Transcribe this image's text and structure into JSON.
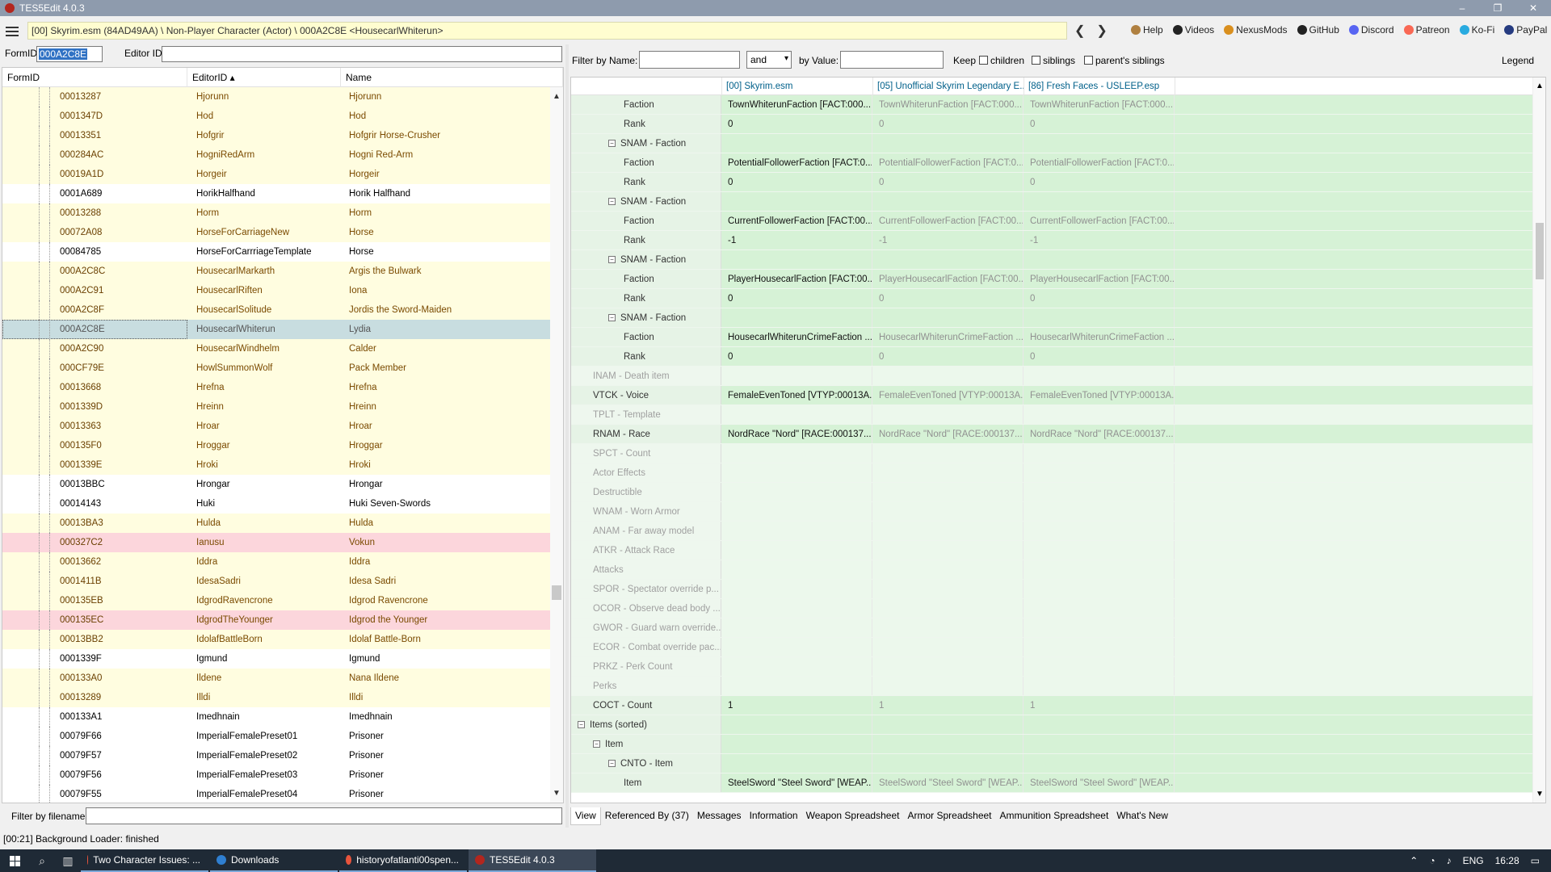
{
  "window": {
    "title": "TES5Edit 4.0.3",
    "controls": [
      "–",
      "❐",
      "✕"
    ]
  },
  "pathbar": {
    "path": "[00] Skyrim.esm (84AD49AA) \\ Non-Player Character (Actor) \\ 000A2C8E <HousecarlWhiterun>"
  },
  "nav": {
    "back": "❮",
    "forward": "❯"
  },
  "links": [
    {
      "label": "Help",
      "color": "#b08040"
    },
    {
      "label": "Videos",
      "color": "#222222"
    },
    {
      "label": "NexusMods",
      "color": "#d98f1e"
    },
    {
      "label": "GitHub",
      "color": "#222222"
    },
    {
      "label": "Discord",
      "color": "#5865f2"
    },
    {
      "label": "Patreon",
      "color": "#f96854"
    },
    {
      "label": "Ko-Fi",
      "color": "#29abe0"
    },
    {
      "label": "PayPal",
      "color": "#253b80"
    }
  ],
  "left_filter": {
    "formid_label": "FormID",
    "formid_value": "000A2C8E",
    "editorid_label": "Editor ID",
    "editorid_value": ""
  },
  "left_columns": [
    "FormID",
    "EditorID ▴",
    "Name"
  ],
  "left_rows": [
    {
      "formid": "00013287",
      "editorid": "Hjorunn",
      "name": "Hjorunn",
      "style": "y"
    },
    {
      "formid": "0001347D",
      "editorid": "Hod",
      "name": "Hod",
      "style": "y"
    },
    {
      "formid": "00013351",
      "editorid": "Hofgrir",
      "name": "Hofgrir Horse-Crusher",
      "style": "y"
    },
    {
      "formid": "000284AC",
      "editorid": "HogniRedArm",
      "name": "Hogni Red-Arm",
      "style": "y"
    },
    {
      "formid": "00019A1D",
      "editorid": "Horgeir",
      "name": "Horgeir",
      "style": "y"
    },
    {
      "formid": "0001A689",
      "editorid": "HorikHalfhand",
      "name": "Horik Halfhand",
      "style": "w"
    },
    {
      "formid": "00013288",
      "editorid": "Horm",
      "name": "Horm",
      "style": "y"
    },
    {
      "formid": "00072A08",
      "editorid": "HorseForCarriageNew",
      "name": "Horse",
      "style": "y"
    },
    {
      "formid": "00084785",
      "editorid": "HorseForCarrriageTemplate",
      "name": "Horse",
      "style": "w"
    },
    {
      "formid": "000A2C8C",
      "editorid": "HousecarlMarkarth",
      "name": "Argis the Bulwark",
      "style": "y"
    },
    {
      "formid": "000A2C91",
      "editorid": "HousecarlRiften",
      "name": "Iona",
      "style": "y"
    },
    {
      "formid": "000A2C8F",
      "editorid": "HousecarlSolitude",
      "name": "Jordis the Sword-Maiden",
      "style": "y"
    },
    {
      "formid": "000A2C8E",
      "editorid": "HousecarlWhiterun",
      "name": "Lydia",
      "style": "sel"
    },
    {
      "formid": "000A2C90",
      "editorid": "HousecarlWindhelm",
      "name": "Calder",
      "style": "y"
    },
    {
      "formid": "000CF79E",
      "editorid": "HowlSummonWolf",
      "name": "Pack Member",
      "style": "y"
    },
    {
      "formid": "00013668",
      "editorid": "Hrefna",
      "name": "Hrefna",
      "style": "y"
    },
    {
      "formid": "0001339D",
      "editorid": "Hreinn",
      "name": "Hreinn",
      "style": "y"
    },
    {
      "formid": "00013363",
      "editorid": "Hroar",
      "name": "Hroar",
      "style": "y"
    },
    {
      "formid": "000135F0",
      "editorid": "Hroggar",
      "name": "Hroggar",
      "style": "y"
    },
    {
      "formid": "0001339E",
      "editorid": "Hroki",
      "name": "Hroki",
      "style": "y"
    },
    {
      "formid": "00013BBC",
      "editorid": "Hrongar",
      "name": "Hrongar",
      "style": "w"
    },
    {
      "formid": "00014143",
      "editorid": "Huki",
      "name": "Huki Seven-Swords",
      "style": "w"
    },
    {
      "formid": "00013BA3",
      "editorid": "Hulda",
      "name": "Hulda",
      "style": "y"
    },
    {
      "formid": "000327C2",
      "editorid": "Ianusu",
      "name": "Vokun",
      "style": "p"
    },
    {
      "formid": "00013662",
      "editorid": "Iddra",
      "name": "Iddra",
      "style": "y"
    },
    {
      "formid": "0001411B",
      "editorid": "IdesaSadri",
      "name": "Idesa Sadri",
      "style": "y"
    },
    {
      "formid": "000135EB",
      "editorid": "IdgrodRavencrone",
      "name": "Idgrod Ravencrone",
      "style": "y"
    },
    {
      "formid": "000135EC",
      "editorid": "IdgrodTheYounger",
      "name": "Idgrod the Younger",
      "style": "p"
    },
    {
      "formid": "00013BB2",
      "editorid": "IdolafBattleBorn",
      "name": "Idolaf Battle-Born",
      "style": "y"
    },
    {
      "formid": "0001339F",
      "editorid": "Igmund",
      "name": "Igmund",
      "style": "w"
    },
    {
      "formid": "000133A0",
      "editorid": "Ildene",
      "name": "Nana Ildene",
      "style": "y"
    },
    {
      "formid": "00013289",
      "editorid": "Illdi",
      "name": "Illdi",
      "style": "y"
    },
    {
      "formid": "000133A1",
      "editorid": "Imedhnain",
      "name": "Imedhnain",
      "style": "w"
    },
    {
      "formid": "00079F66",
      "editorid": "ImperialFemalePreset01",
      "name": "Prisoner",
      "style": "w"
    },
    {
      "formid": "00079F57",
      "editorid": "ImperialFemalePreset02",
      "name": "Prisoner",
      "style": "w"
    },
    {
      "formid": "00079F56",
      "editorid": "ImperialFemalePreset03",
      "name": "Prisoner",
      "style": "w"
    },
    {
      "formid": "00079F55",
      "editorid": "ImperialFemalePreset04",
      "name": "Prisoner",
      "style": "w"
    }
  ],
  "filename_filter": {
    "label": "Filter by filename:",
    "value": ""
  },
  "right_filter": {
    "by_name_label": "Filter by Name:",
    "operator": "and",
    "by_value_label": "by Value:",
    "keep_label": "Keep",
    "children_label": "children",
    "siblings_label": "siblings",
    "parents_siblings_label": "parent's siblings",
    "legend_label": "Legend"
  },
  "right_columns": [
    "",
    "[00] Skyrim.esm",
    "[05] Unofficial Skyrim Legendary E...",
    "[86] Fresh Faces - USLEEP.esp"
  ],
  "right_rows": [
    {
      "label": "Faction",
      "indent": 3,
      "toggle": "",
      "v": [
        "TownWhiterunFaction [FACT:000...",
        "TownWhiterunFaction [FACT:000...",
        "TownWhiterunFaction [FACT:000..."
      ],
      "empty": false
    },
    {
      "label": "Rank",
      "indent": 3,
      "toggle": "",
      "v": [
        "0",
        "0",
        "0"
      ],
      "empty": false
    },
    {
      "label": "SNAM - Faction",
      "indent": 2,
      "toggle": "⊟",
      "v": [
        "",
        "",
        ""
      ],
      "empty": false
    },
    {
      "label": "Faction",
      "indent": 3,
      "toggle": "",
      "v": [
        "PotentialFollowerFaction [FACT:0...",
        "PotentialFollowerFaction [FACT:0...",
        "PotentialFollowerFaction [FACT:0..."
      ],
      "empty": false
    },
    {
      "label": "Rank",
      "indent": 3,
      "toggle": "",
      "v": [
        "0",
        "0",
        "0"
      ],
      "empty": false
    },
    {
      "label": "SNAM - Faction",
      "indent": 2,
      "toggle": "⊟",
      "v": [
        "",
        "",
        ""
      ],
      "empty": false
    },
    {
      "label": "Faction",
      "indent": 3,
      "toggle": "",
      "v": [
        "CurrentFollowerFaction [FACT:00...",
        "CurrentFollowerFaction [FACT:00...",
        "CurrentFollowerFaction [FACT:00..."
      ],
      "empty": false
    },
    {
      "label": "Rank",
      "indent": 3,
      "toggle": "",
      "v": [
        "-1",
        "-1",
        "-1"
      ],
      "empty": false
    },
    {
      "label": "SNAM - Faction",
      "indent": 2,
      "toggle": "⊟",
      "v": [
        "",
        "",
        ""
      ],
      "empty": false
    },
    {
      "label": "Faction",
      "indent": 3,
      "toggle": "",
      "v": [
        "PlayerHousecarlFaction [FACT:00...",
        "PlayerHousecarlFaction [FACT:00...",
        "PlayerHousecarlFaction [FACT:00..."
      ],
      "empty": false
    },
    {
      "label": "Rank",
      "indent": 3,
      "toggle": "",
      "v": [
        "0",
        "0",
        "0"
      ],
      "empty": false
    },
    {
      "label": "SNAM - Faction",
      "indent": 2,
      "toggle": "⊟",
      "v": [
        "",
        "",
        ""
      ],
      "empty": false
    },
    {
      "label": "Faction",
      "indent": 3,
      "toggle": "",
      "v": [
        "HousecarlWhiterunCrimeFaction ...",
        "HousecarlWhiterunCrimeFaction ...",
        "HousecarlWhiterunCrimeFaction ..."
      ],
      "empty": false
    },
    {
      "label": "Rank",
      "indent": 3,
      "toggle": "",
      "v": [
        "0",
        "0",
        "0"
      ],
      "empty": false
    },
    {
      "label": "INAM - Death item",
      "indent": 1,
      "toggle": "",
      "v": [
        "",
        "",
        ""
      ],
      "empty": true
    },
    {
      "label": "VTCK - Voice",
      "indent": 1,
      "toggle": "",
      "v": [
        "FemaleEvenToned [VTYP:00013A...",
        "FemaleEvenToned [VTYP:00013A...",
        "FemaleEvenToned [VTYP:00013A..."
      ],
      "empty": false
    },
    {
      "label": "TPLT - Template",
      "indent": 1,
      "toggle": "",
      "v": [
        "",
        "",
        ""
      ],
      "empty": true
    },
    {
      "label": "RNAM - Race",
      "indent": 1,
      "toggle": "",
      "v": [
        "NordRace \"Nord\" [RACE:000137...",
        "NordRace \"Nord\" [RACE:000137...",
        "NordRace \"Nord\" [RACE:000137..."
      ],
      "empty": false
    },
    {
      "label": "SPCT - Count",
      "indent": 1,
      "toggle": "",
      "v": [
        "",
        "",
        ""
      ],
      "empty": true
    },
    {
      "label": "Actor Effects",
      "indent": 1,
      "toggle": "",
      "v": [
        "",
        "",
        ""
      ],
      "empty": true
    },
    {
      "label": "Destructible",
      "indent": 1,
      "toggle": "",
      "v": [
        "",
        "",
        ""
      ],
      "empty": true
    },
    {
      "label": "WNAM - Worn Armor",
      "indent": 1,
      "toggle": "",
      "v": [
        "",
        "",
        ""
      ],
      "empty": true
    },
    {
      "label": "ANAM - Far away model",
      "indent": 1,
      "toggle": "",
      "v": [
        "",
        "",
        ""
      ],
      "empty": true
    },
    {
      "label": "ATKR - Attack Race",
      "indent": 1,
      "toggle": "",
      "v": [
        "",
        "",
        ""
      ],
      "empty": true
    },
    {
      "label": "Attacks",
      "indent": 1,
      "toggle": "",
      "v": [
        "",
        "",
        ""
      ],
      "empty": true
    },
    {
      "label": "SPOR - Spectator override p...",
      "indent": 1,
      "toggle": "",
      "v": [
        "",
        "",
        ""
      ],
      "empty": true
    },
    {
      "label": "OCOR - Observe dead body ...",
      "indent": 1,
      "toggle": "",
      "v": [
        "",
        "",
        ""
      ],
      "empty": true
    },
    {
      "label": "GWOR - Guard warn override...",
      "indent": 1,
      "toggle": "",
      "v": [
        "",
        "",
        ""
      ],
      "empty": true
    },
    {
      "label": "ECOR - Combat override pac...",
      "indent": 1,
      "toggle": "",
      "v": [
        "",
        "",
        ""
      ],
      "empty": true
    },
    {
      "label": "PRKZ - Perk Count",
      "indent": 1,
      "toggle": "",
      "v": [
        "",
        "",
        ""
      ],
      "empty": true
    },
    {
      "label": "Perks",
      "indent": 1,
      "toggle": "",
      "v": [
        "",
        "",
        ""
      ],
      "empty": true
    },
    {
      "label": "COCT - Count",
      "indent": 1,
      "toggle": "",
      "v": [
        "1",
        "1",
        "1"
      ],
      "empty": false
    },
    {
      "label": "Items (sorted)",
      "indent": 0,
      "toggle": "⊟",
      "v": [
        "",
        "",
        ""
      ],
      "empty": false
    },
    {
      "label": "Item",
      "indent": 1,
      "toggle": "⊟",
      "v": [
        "",
        "",
        ""
      ],
      "empty": false
    },
    {
      "label": "CNTO - Item",
      "indent": 2,
      "toggle": "⊟",
      "v": [
        "",
        "",
        ""
      ],
      "empty": false
    },
    {
      "label": "Item",
      "indent": 3,
      "toggle": "",
      "v": [
        "SteelSword \"Steel Sword\" [WEAP...",
        "SteelSword \"Steel Sword\" [WEAP...",
        "SteelSword \"Steel Sword\" [WEAP..."
      ],
      "empty": false
    }
  ],
  "bottom_tabs": [
    "View",
    "Referenced By (37)",
    "Messages",
    "Information",
    "Weapon Spreadsheet",
    "Armor Spreadsheet",
    "Ammunition Spreadsheet",
    "What's New"
  ],
  "status": "[00:21] Background Loader: finished",
  "taskbar": {
    "tasks": [
      {
        "label": "Two Character Issues: ...",
        "color": "#e8543c"
      },
      {
        "label": "Downloads",
        "color": "#2f7fd1"
      },
      {
        "label": "historyofatlanti00spen...",
        "color": "#e8543c"
      },
      {
        "label": "TES5Edit 4.0.3",
        "color": "#b3261e"
      }
    ],
    "lang": "ENG",
    "time": "16:28"
  }
}
